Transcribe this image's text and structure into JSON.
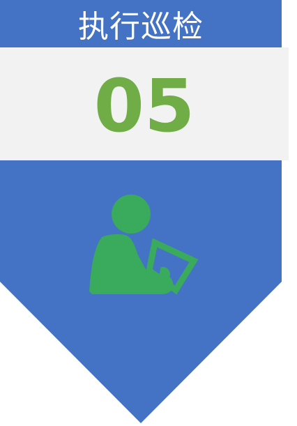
{
  "banner": {
    "title": "执行巡检",
    "number": "05",
    "icon": "inspector-clipboard-icon"
  },
  "colors": {
    "banner_blue": "#4472c4",
    "panel_gray": "#f2f2f2",
    "number_green": "#70ad47",
    "icon_green": "#3aaa5c"
  }
}
